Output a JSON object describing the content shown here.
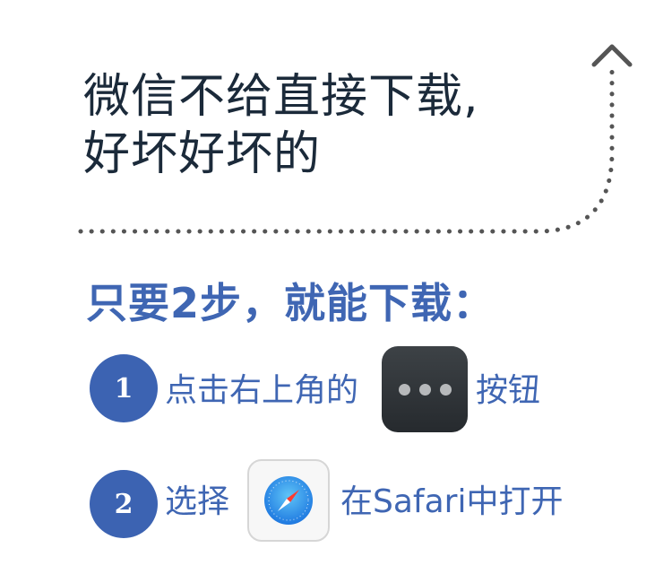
{
  "headline": {
    "line1": "微信不给直接下载,",
    "line2": "好坏好坏的"
  },
  "steps_title": "只要2步，就能下载：",
  "steps": [
    {
      "number": "1",
      "text_before": "点击右上角的",
      "icon": "more-dots-icon",
      "text_after": "按钮"
    },
    {
      "number": "2",
      "text_before": "选择",
      "icon": "safari-compass-icon",
      "text_after": "在Safari中打开"
    }
  ],
  "colors": {
    "headline": "#1b2a3a",
    "accent": "#3f66b3",
    "badge": "#3c63b2",
    "dots": "#555555"
  }
}
